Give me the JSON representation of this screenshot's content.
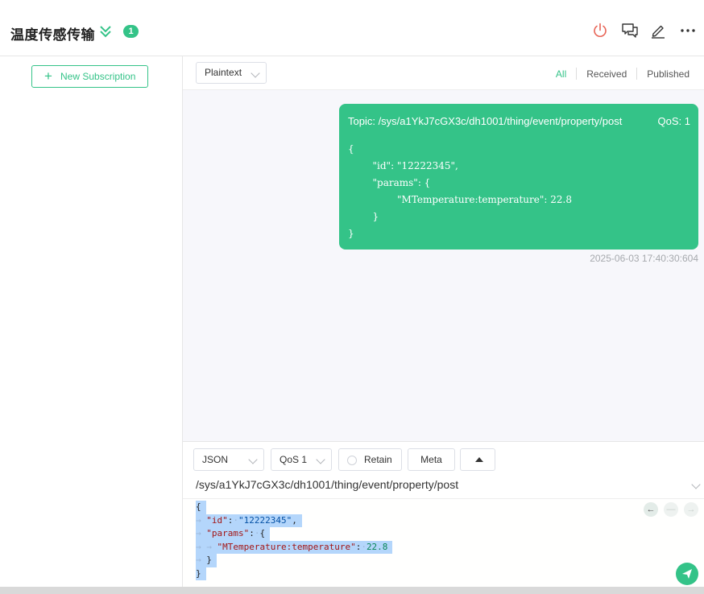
{
  "header": {
    "title": "温度传感传输",
    "badge_count": "1",
    "accent_color": "#34c388",
    "disconnect_color": "#e86355",
    "icons": [
      "double-chevron-down-icon",
      "power-icon",
      "chat-bubbles-icon",
      "edit-pencil-icon",
      "more-icon"
    ]
  },
  "sidebar": {
    "new_subscription_label": "New Subscription"
  },
  "toolbar": {
    "format_value": "Plaintext",
    "filters": [
      "All",
      "Received",
      "Published"
    ],
    "active_filter": "All"
  },
  "message": {
    "topic": "Topic: /sys/a1YkJ7cGX3c/dh1001/thing/event/property/post",
    "qos": "QoS: 1",
    "payload": "{\n        \"id\": \"12222345\",\n        \"params\": {\n                \"MTemperature:temperature\": 22.8\n        }\n}",
    "time": "2025-06-03 17:40:30:604"
  },
  "composer": {
    "format_value": "JSON",
    "qos_value": "QoS 1",
    "retain_label": "Retain",
    "meta_label": "Meta",
    "topic": "/sys/a1YkJ7cGX3c/dh1001/thing/event/property/post",
    "code_lines": {
      "l1": "{",
      "l2_key": "\"id\"",
      "l2_val": "\"12222345\"",
      "l3_key": "\"params\"",
      "l4_key": "\"MTemperature:temperature\"",
      "l4_val": "22.8",
      "l5": "}",
      "l6": "}"
    }
  }
}
